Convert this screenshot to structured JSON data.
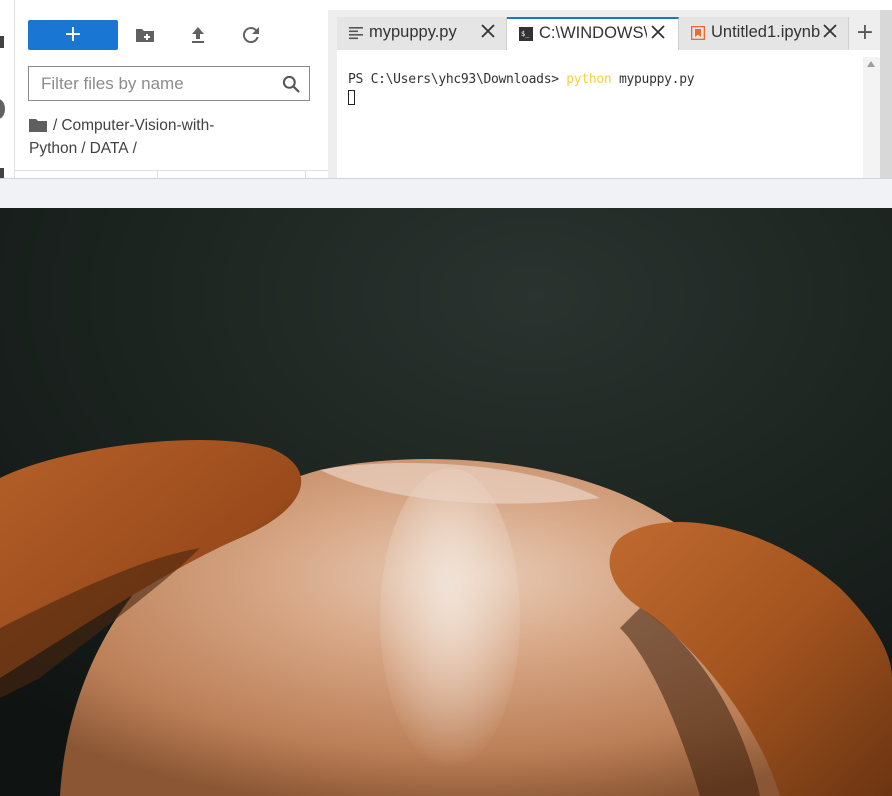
{
  "file_browser": {
    "new_button_label": "+",
    "filter": {
      "placeholder": "Filter files by name",
      "value": ""
    },
    "breadcrumbs": [
      "Computer-Vision-with-Python",
      "DATA"
    ],
    "breadcrumb_sep": "/"
  },
  "tabs": [
    {
      "label": "mypuppy.py",
      "icon": "text-file-icon",
      "active": false
    },
    {
      "label": "C:\\WINDOWS\\S",
      "icon": "terminal-icon",
      "active": true
    },
    {
      "label": "Untitled1.ipynb",
      "icon": "notebook-icon",
      "active": false
    }
  ],
  "add_tab_label": "+",
  "terminal": {
    "prompt": "PS C:\\Users\\yhc93\\Downloads> ",
    "command": "python",
    "argument": " mypuppy.py"
  },
  "image_viewer": {
    "content": "puppy-head-photo"
  },
  "colors": {
    "accent": "#1976d2",
    "terminal_command": "#f4d03f",
    "notebook_icon": "#e46e2e"
  }
}
